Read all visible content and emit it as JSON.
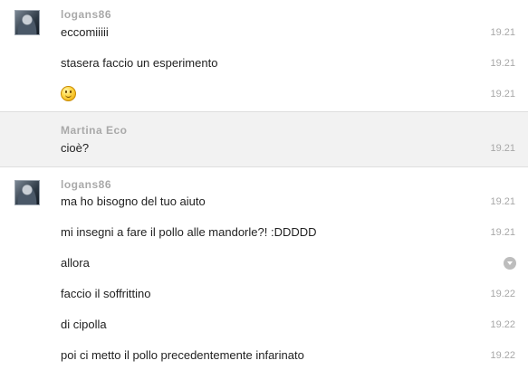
{
  "groups": [
    {
      "sender": "logans86",
      "messages": [
        {
          "text": "eccomiiiii",
          "time": "19.21"
        },
        {
          "text": "stasera faccio un esperimento",
          "time": "19.21"
        },
        {
          "emoji": "smiley-icon",
          "time": "19.21"
        }
      ]
    },
    {
      "sender": "Martina Eco",
      "messages": [
        {
          "text": "cioè?",
          "time": "19.21"
        }
      ]
    },
    {
      "sender": "logans86",
      "messages": [
        {
          "text": "ma ho bisogno del tuo aiuto",
          "time": "19.21"
        },
        {
          "text": "mi insegni a fare il pollo alle mandorle?! :DDDDD",
          "time": "19.21"
        },
        {
          "text": "allora",
          "icon": "chevron-down-icon"
        },
        {
          "text": "faccio il soffrittino",
          "time": "19.22"
        },
        {
          "text": "di cipolla",
          "time": "19.22"
        },
        {
          "text": "poi ci metto il pollo precedentemente infarinato",
          "time": "19.22"
        }
      ]
    }
  ]
}
